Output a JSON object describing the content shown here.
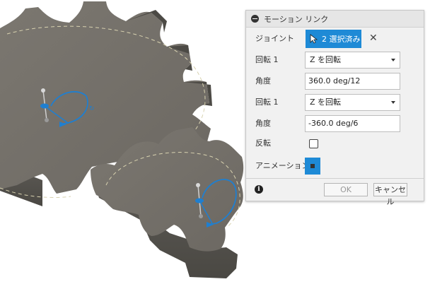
{
  "dialog": {
    "title": "モーション リンク",
    "joint_label": "ジョイント",
    "selection_label": "2 選択済み",
    "clear_symbol": "✕",
    "rotation1_label": "回転 1",
    "rotation1_value": "Z を回転",
    "angle1_label": "角度",
    "angle1_value": "360.0 deg/12",
    "rotation2_label": "回転 1",
    "rotation2_value": "Z を回転",
    "angle2_label": "角度",
    "angle2_value": "-360.0 deg/6",
    "reverse_label": "反転",
    "reverse_checked": false,
    "animation_label": "アニメーション",
    "info_symbol": "i",
    "ok_label": "OK",
    "cancel_label": "キャンセル"
  },
  "colors": {
    "accent": "#1e8ad6",
    "gear_face": "#74706a",
    "gear_side": "#55524d",
    "joint_glyph": "#1f7fd0"
  },
  "icons": {
    "cursor": "cursor-icon",
    "collapse": "collapse-icon",
    "info": "info-icon",
    "clear": "close-icon"
  }
}
